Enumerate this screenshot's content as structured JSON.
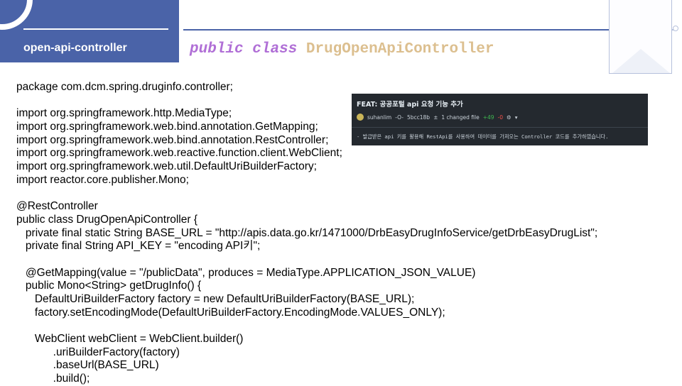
{
  "section": {
    "label": "open-api-controller"
  },
  "title": {
    "kw1": "public",
    "kw2": "class",
    "name": "DrugOpenApiController"
  },
  "code_lines": [
    "package com.dcm.spring.druginfo.controller;",
    "",
    "import org.springframework.http.MediaType;",
    "import org.springframework.web.bind.annotation.GetMapping;",
    "import org.springframework.web.bind.annotation.RestController;",
    "import org.springframework.web.reactive.function.client.WebClient;",
    "import org.springframework.web.util.DefaultUriBuilderFactory;",
    "import reactor.core.publisher.Mono;",
    "",
    "@RestController",
    "public class DrugOpenApiController {",
    "   private final static String BASE_URL = \"http://apis.data.go.kr/1471000/DrbEasyDrugInfoService/getDrbEasyDrugList\";",
    "   private final String API_KEY = \"encoding API키\";",
    "",
    "   @GetMapping(value = \"/publicData\", produces = MediaType.APPLICATION_JSON_VALUE)",
    "   public Mono<String> getDrugInfo() {",
    "      DefaultUriBuilderFactory factory = new DefaultUriBuilderFactory(BASE_URL);",
    "      factory.setEncodingMode(DefaultUriBuilderFactory.EncodingMode.VALUES_ONLY);",
    "",
    "      WebClient webClient = WebClient.builder()",
    "            .uriBuilderFactory(factory)",
    "            .baseUrl(BASE_URL)",
    "            .build();"
  ],
  "commit": {
    "title": "FEAT: 공공포털 api 요청 기능 추가",
    "author": "suhanlim",
    "hash": "5bcc18b",
    "files_changed": "1 changed file",
    "additions": "+49",
    "deletions": "-0",
    "description": "- 발급받은 api 키를 활용해 RestApi를 사용하여 데이터를 가져오는 Controller 코드를 추가하였습니다."
  },
  "icons": {
    "commit": "git-commit-icon",
    "diff": "plus-minus-icon",
    "settings": "gear-icon",
    "dropdown": "caret-down-icon"
  },
  "colors": {
    "accent": "#4a63a8",
    "keyword": "#b06fd6",
    "class_name": "#dcbf8f",
    "commit_bg": "#24292f",
    "additions": "#3fb950",
    "deletions": "#f85149"
  }
}
